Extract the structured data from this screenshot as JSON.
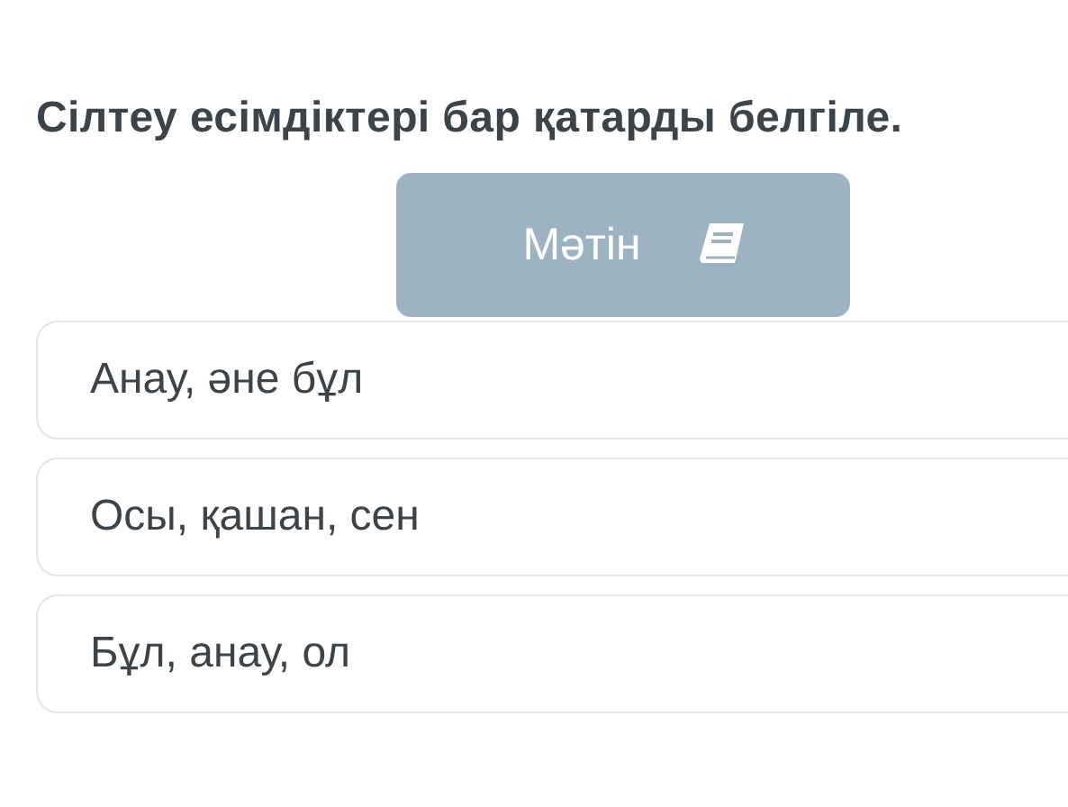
{
  "question": "Сілтеу есімдіктері бар қатарды белгіле.",
  "text_button": {
    "label": "Мәтін"
  },
  "options": [
    {
      "label": "Анау, әне бұл"
    },
    {
      "label": "Осы, қашан, сен"
    },
    {
      "label": "Бұл, анау, ол"
    }
  ]
}
